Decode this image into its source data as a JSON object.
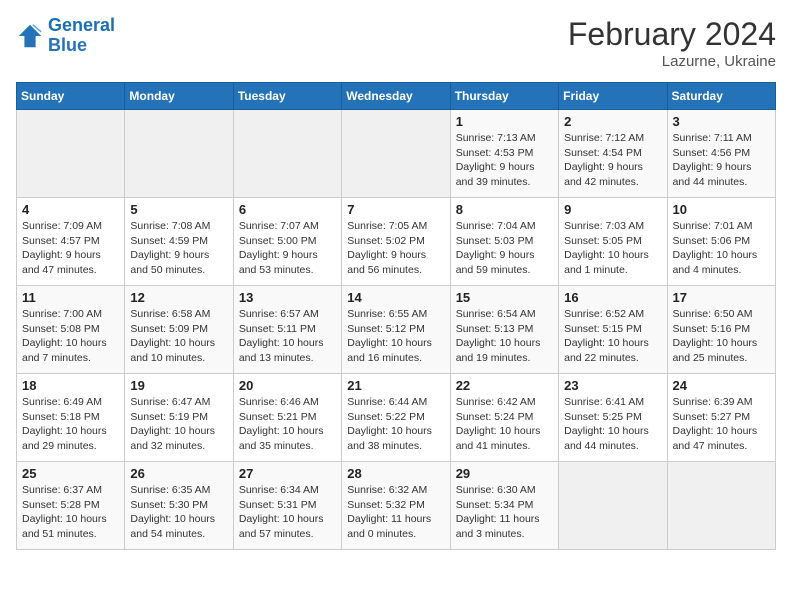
{
  "header": {
    "logo_general": "General",
    "logo_blue": "Blue",
    "title": "February 2024",
    "subtitle": "Lazurne, Ukraine"
  },
  "days_of_week": [
    "Sunday",
    "Monday",
    "Tuesday",
    "Wednesday",
    "Thursday",
    "Friday",
    "Saturday"
  ],
  "weeks": [
    [
      {
        "day": "",
        "info": ""
      },
      {
        "day": "",
        "info": ""
      },
      {
        "day": "",
        "info": ""
      },
      {
        "day": "",
        "info": ""
      },
      {
        "day": "1",
        "info": "Sunrise: 7:13 AM\nSunset: 4:53 PM\nDaylight: 9 hours and 39 minutes."
      },
      {
        "day": "2",
        "info": "Sunrise: 7:12 AM\nSunset: 4:54 PM\nDaylight: 9 hours and 42 minutes."
      },
      {
        "day": "3",
        "info": "Sunrise: 7:11 AM\nSunset: 4:56 PM\nDaylight: 9 hours and 44 minutes."
      }
    ],
    [
      {
        "day": "4",
        "info": "Sunrise: 7:09 AM\nSunset: 4:57 PM\nDaylight: 9 hours and 47 minutes."
      },
      {
        "day": "5",
        "info": "Sunrise: 7:08 AM\nSunset: 4:59 PM\nDaylight: 9 hours and 50 minutes."
      },
      {
        "day": "6",
        "info": "Sunrise: 7:07 AM\nSunset: 5:00 PM\nDaylight: 9 hours and 53 minutes."
      },
      {
        "day": "7",
        "info": "Sunrise: 7:05 AM\nSunset: 5:02 PM\nDaylight: 9 hours and 56 minutes."
      },
      {
        "day": "8",
        "info": "Sunrise: 7:04 AM\nSunset: 5:03 PM\nDaylight: 9 hours and 59 minutes."
      },
      {
        "day": "9",
        "info": "Sunrise: 7:03 AM\nSunset: 5:05 PM\nDaylight: 10 hours and 1 minute."
      },
      {
        "day": "10",
        "info": "Sunrise: 7:01 AM\nSunset: 5:06 PM\nDaylight: 10 hours and 4 minutes."
      }
    ],
    [
      {
        "day": "11",
        "info": "Sunrise: 7:00 AM\nSunset: 5:08 PM\nDaylight: 10 hours and 7 minutes."
      },
      {
        "day": "12",
        "info": "Sunrise: 6:58 AM\nSunset: 5:09 PM\nDaylight: 10 hours and 10 minutes."
      },
      {
        "day": "13",
        "info": "Sunrise: 6:57 AM\nSunset: 5:11 PM\nDaylight: 10 hours and 13 minutes."
      },
      {
        "day": "14",
        "info": "Sunrise: 6:55 AM\nSunset: 5:12 PM\nDaylight: 10 hours and 16 minutes."
      },
      {
        "day": "15",
        "info": "Sunrise: 6:54 AM\nSunset: 5:13 PM\nDaylight: 10 hours and 19 minutes."
      },
      {
        "day": "16",
        "info": "Sunrise: 6:52 AM\nSunset: 5:15 PM\nDaylight: 10 hours and 22 minutes."
      },
      {
        "day": "17",
        "info": "Sunrise: 6:50 AM\nSunset: 5:16 PM\nDaylight: 10 hours and 25 minutes."
      }
    ],
    [
      {
        "day": "18",
        "info": "Sunrise: 6:49 AM\nSunset: 5:18 PM\nDaylight: 10 hours and 29 minutes."
      },
      {
        "day": "19",
        "info": "Sunrise: 6:47 AM\nSunset: 5:19 PM\nDaylight: 10 hours and 32 minutes."
      },
      {
        "day": "20",
        "info": "Sunrise: 6:46 AM\nSunset: 5:21 PM\nDaylight: 10 hours and 35 minutes."
      },
      {
        "day": "21",
        "info": "Sunrise: 6:44 AM\nSunset: 5:22 PM\nDaylight: 10 hours and 38 minutes."
      },
      {
        "day": "22",
        "info": "Sunrise: 6:42 AM\nSunset: 5:24 PM\nDaylight: 10 hours and 41 minutes."
      },
      {
        "day": "23",
        "info": "Sunrise: 6:41 AM\nSunset: 5:25 PM\nDaylight: 10 hours and 44 minutes."
      },
      {
        "day": "24",
        "info": "Sunrise: 6:39 AM\nSunset: 5:27 PM\nDaylight: 10 hours and 47 minutes."
      }
    ],
    [
      {
        "day": "25",
        "info": "Sunrise: 6:37 AM\nSunset: 5:28 PM\nDaylight: 10 hours and 51 minutes."
      },
      {
        "day": "26",
        "info": "Sunrise: 6:35 AM\nSunset: 5:30 PM\nDaylight: 10 hours and 54 minutes."
      },
      {
        "day": "27",
        "info": "Sunrise: 6:34 AM\nSunset: 5:31 PM\nDaylight: 10 hours and 57 minutes."
      },
      {
        "day": "28",
        "info": "Sunrise: 6:32 AM\nSunset: 5:32 PM\nDaylight: 11 hours and 0 minutes."
      },
      {
        "day": "29",
        "info": "Sunrise: 6:30 AM\nSunset: 5:34 PM\nDaylight: 11 hours and 3 minutes."
      },
      {
        "day": "",
        "info": ""
      },
      {
        "day": "",
        "info": ""
      }
    ]
  ]
}
